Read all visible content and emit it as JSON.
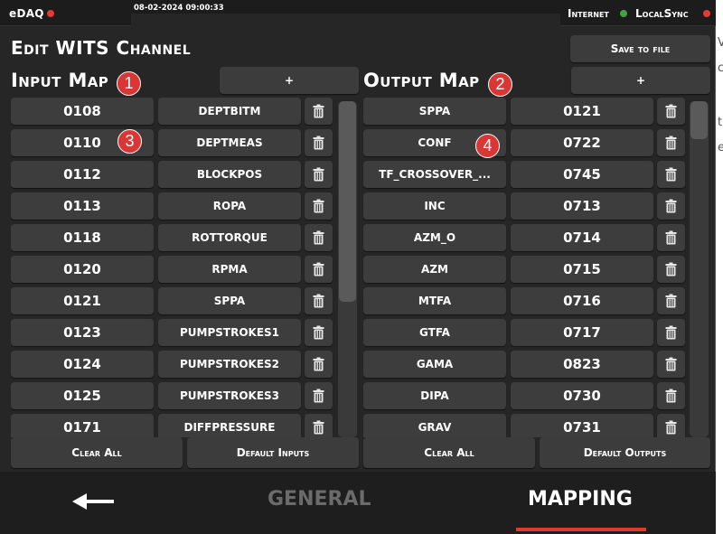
{
  "status_bar": {
    "app_name": "eDAQ",
    "datetime": "08-02-2024 09:00:33",
    "internet_label": "Internet",
    "localsync_label": "LocalSync",
    "colors": {
      "error": "#e53935",
      "ok": "#43a047"
    }
  },
  "panel": {
    "title": "Edit WITS Channel",
    "save_label": "Save to file"
  },
  "input_map": {
    "title": "Input Map",
    "add_label": "+",
    "marker": "1",
    "row_marker": "3",
    "rows": [
      {
        "code": "0108",
        "name": "DEPTBITM"
      },
      {
        "code": "0110",
        "name": "DEPTMEAS"
      },
      {
        "code": "0112",
        "name": "BLOCKPOS"
      },
      {
        "code": "0113",
        "name": "ROPA"
      },
      {
        "code": "0118",
        "name": "ROTTORQUE"
      },
      {
        "code": "0120",
        "name": "RPMA"
      },
      {
        "code": "0121",
        "name": "SPPA"
      },
      {
        "code": "0123",
        "name": "PUMPSTROKES1"
      },
      {
        "code": "0124",
        "name": "PUMPSTROKES2"
      },
      {
        "code": "0125",
        "name": "PUMPSTROKES3"
      },
      {
        "code": "0171",
        "name": "DIFFPRESSURE"
      }
    ],
    "clear_label": "Clear All",
    "default_label": "Default Inputs"
  },
  "output_map": {
    "title": "Output Map",
    "add_label": "+",
    "marker": "2",
    "row_marker": "4",
    "rows": [
      {
        "name": "SPPA",
        "code": "0121"
      },
      {
        "name": "CONF",
        "code": "0722"
      },
      {
        "name": "TF_CROSSOVER_...",
        "code": "0745"
      },
      {
        "name": "INC",
        "code": "0713"
      },
      {
        "name": "AZM_O",
        "code": "0714"
      },
      {
        "name": "AZM",
        "code": "0715"
      },
      {
        "name": "MTFA",
        "code": "0716"
      },
      {
        "name": "GTFA",
        "code": "0717"
      },
      {
        "name": "GAMA",
        "code": "0823"
      },
      {
        "name": "DIPA",
        "code": "0730"
      },
      {
        "name": "GRAV",
        "code": "0731"
      }
    ],
    "clear_label": "Clear All",
    "default_label": "Default Outputs"
  },
  "nav": {
    "back_icon": "arrow-left-icon",
    "general_label": "GENERAL",
    "mapping_label": "MAPPING",
    "active": "MAPPING",
    "accent": "#e03a2f"
  }
}
